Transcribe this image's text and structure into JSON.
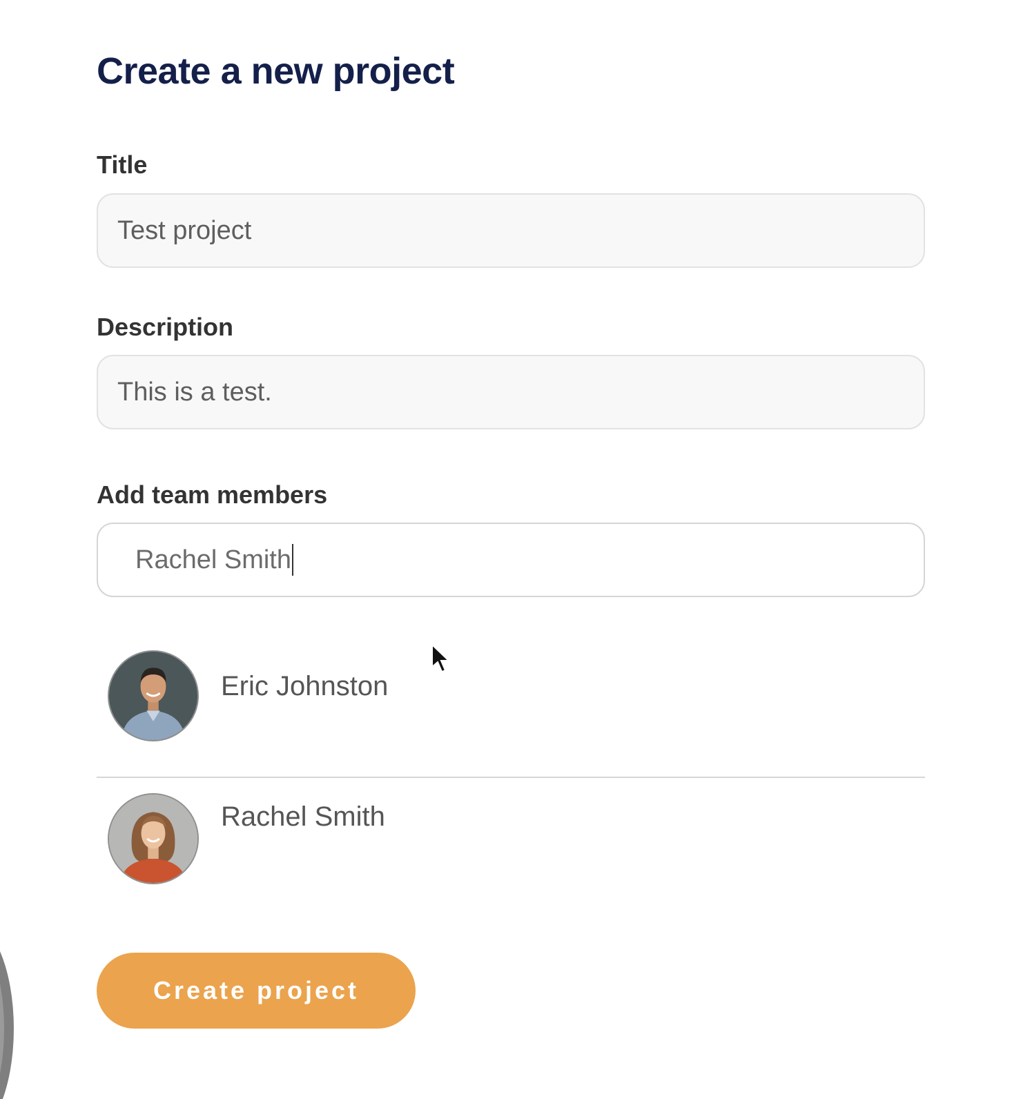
{
  "form": {
    "title": "Create a new project",
    "fields": {
      "title": {
        "label": "Title",
        "value": "Test project"
      },
      "description": {
        "label": "Description",
        "value": "This is a test."
      },
      "team": {
        "label": "Add team members",
        "value": "Rachel Smith"
      }
    },
    "suggestions": [
      {
        "name": "Eric Johnston",
        "avatar": "man-portrait"
      },
      {
        "name": "Rachel Smith",
        "avatar": "woman-portrait"
      }
    ],
    "submit_label": "Create project"
  },
  "colors": {
    "heading": "#14204a",
    "label": "#333333",
    "button": "#eba34d",
    "input_bg": "#f8f8f8"
  },
  "icons": {
    "pointer": "mouse-pointer-icon"
  }
}
